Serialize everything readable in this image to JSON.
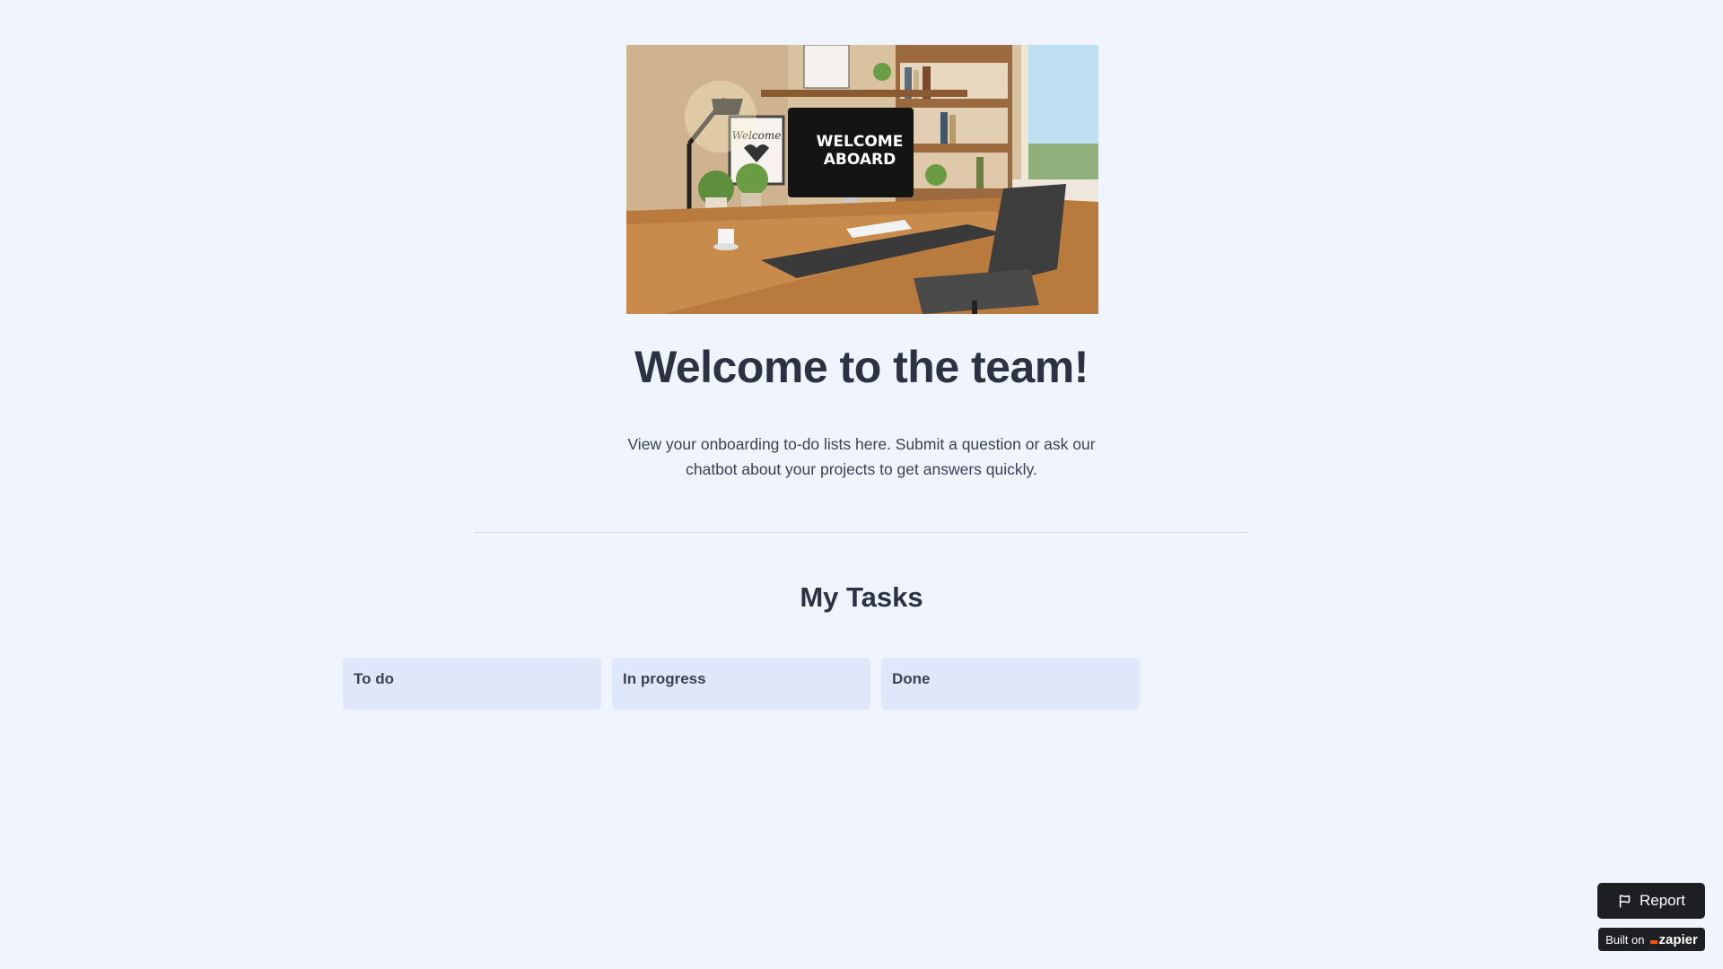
{
  "hero": {
    "monitor_text_line1": "WELCOME",
    "monitor_text_line2": "ABOARD",
    "frame_text": "Welcome"
  },
  "header": {
    "title": "Welcome to the team!",
    "subtitle": "View your onboarding to-do lists here. Submit a question or ask our chatbot about your projects to get answers quickly."
  },
  "tasks": {
    "section_title": "My Tasks",
    "columns": [
      {
        "label": "To do"
      },
      {
        "label": "In progress"
      },
      {
        "label": "Done"
      }
    ]
  },
  "footer": {
    "report_label": "Report",
    "built_on_label": "Built on",
    "brand": "zapier",
    "brand_color": "#ff4f00"
  },
  "colors": {
    "background": "#eff4ff",
    "column_bg": "#dfe7fa",
    "button_bg": "#1e1f22"
  }
}
